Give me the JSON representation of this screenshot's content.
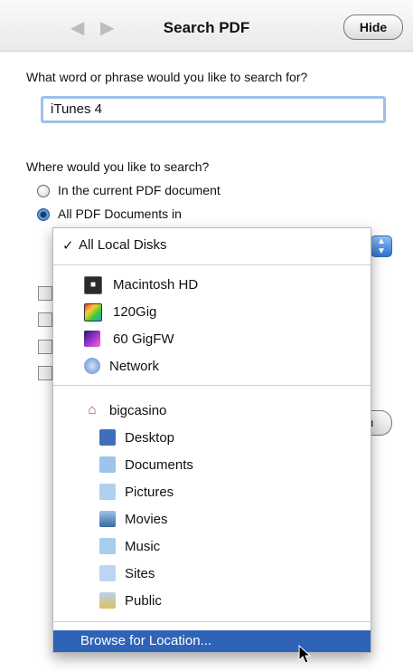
{
  "toolbar": {
    "title": "Search PDF",
    "back_icon": "arrow-left-icon",
    "forward_icon": "arrow-right-icon",
    "hide_label": "Hide"
  },
  "search": {
    "prompt": "What word or phrase would you like to search for?",
    "value": "iTunes 4"
  },
  "where": {
    "prompt": "Where would you like to search?",
    "options": [
      {
        "label": "In the current PDF document",
        "selected": false
      },
      {
        "label": "All PDF Documents in",
        "selected": true
      }
    ]
  },
  "location_menu": {
    "checked": {
      "label": "All Local Disks",
      "check": "✓"
    },
    "disks": [
      {
        "label": "Macintosh HD",
        "icon": "hard-disk-icon"
      },
      {
        "label": "120Gig",
        "icon": "colorful-disk-icon"
      },
      {
        "label": "60 GigFW",
        "icon": "firewire-disk-icon"
      },
      {
        "label": "Network",
        "icon": "globe-icon"
      }
    ],
    "home": {
      "label": "bigcasino",
      "icon": "home-icon"
    },
    "folders": [
      {
        "label": "Desktop",
        "icon": "desktop-folder-icon"
      },
      {
        "label": "Documents",
        "icon": "documents-folder-icon"
      },
      {
        "label": "Pictures",
        "icon": "pictures-folder-icon"
      },
      {
        "label": "Movies",
        "icon": "movies-folder-icon"
      },
      {
        "label": "Music",
        "icon": "music-folder-icon"
      },
      {
        "label": "Sites",
        "icon": "sites-folder-icon"
      },
      {
        "label": "Public",
        "icon": "public-folder-icon"
      }
    ],
    "browse": {
      "label": "Browse for Location..."
    }
  },
  "search_button": {
    "label": "h"
  },
  "colors": {
    "selection": "#2f63b8",
    "focus_ring": "#9ec0e8"
  }
}
